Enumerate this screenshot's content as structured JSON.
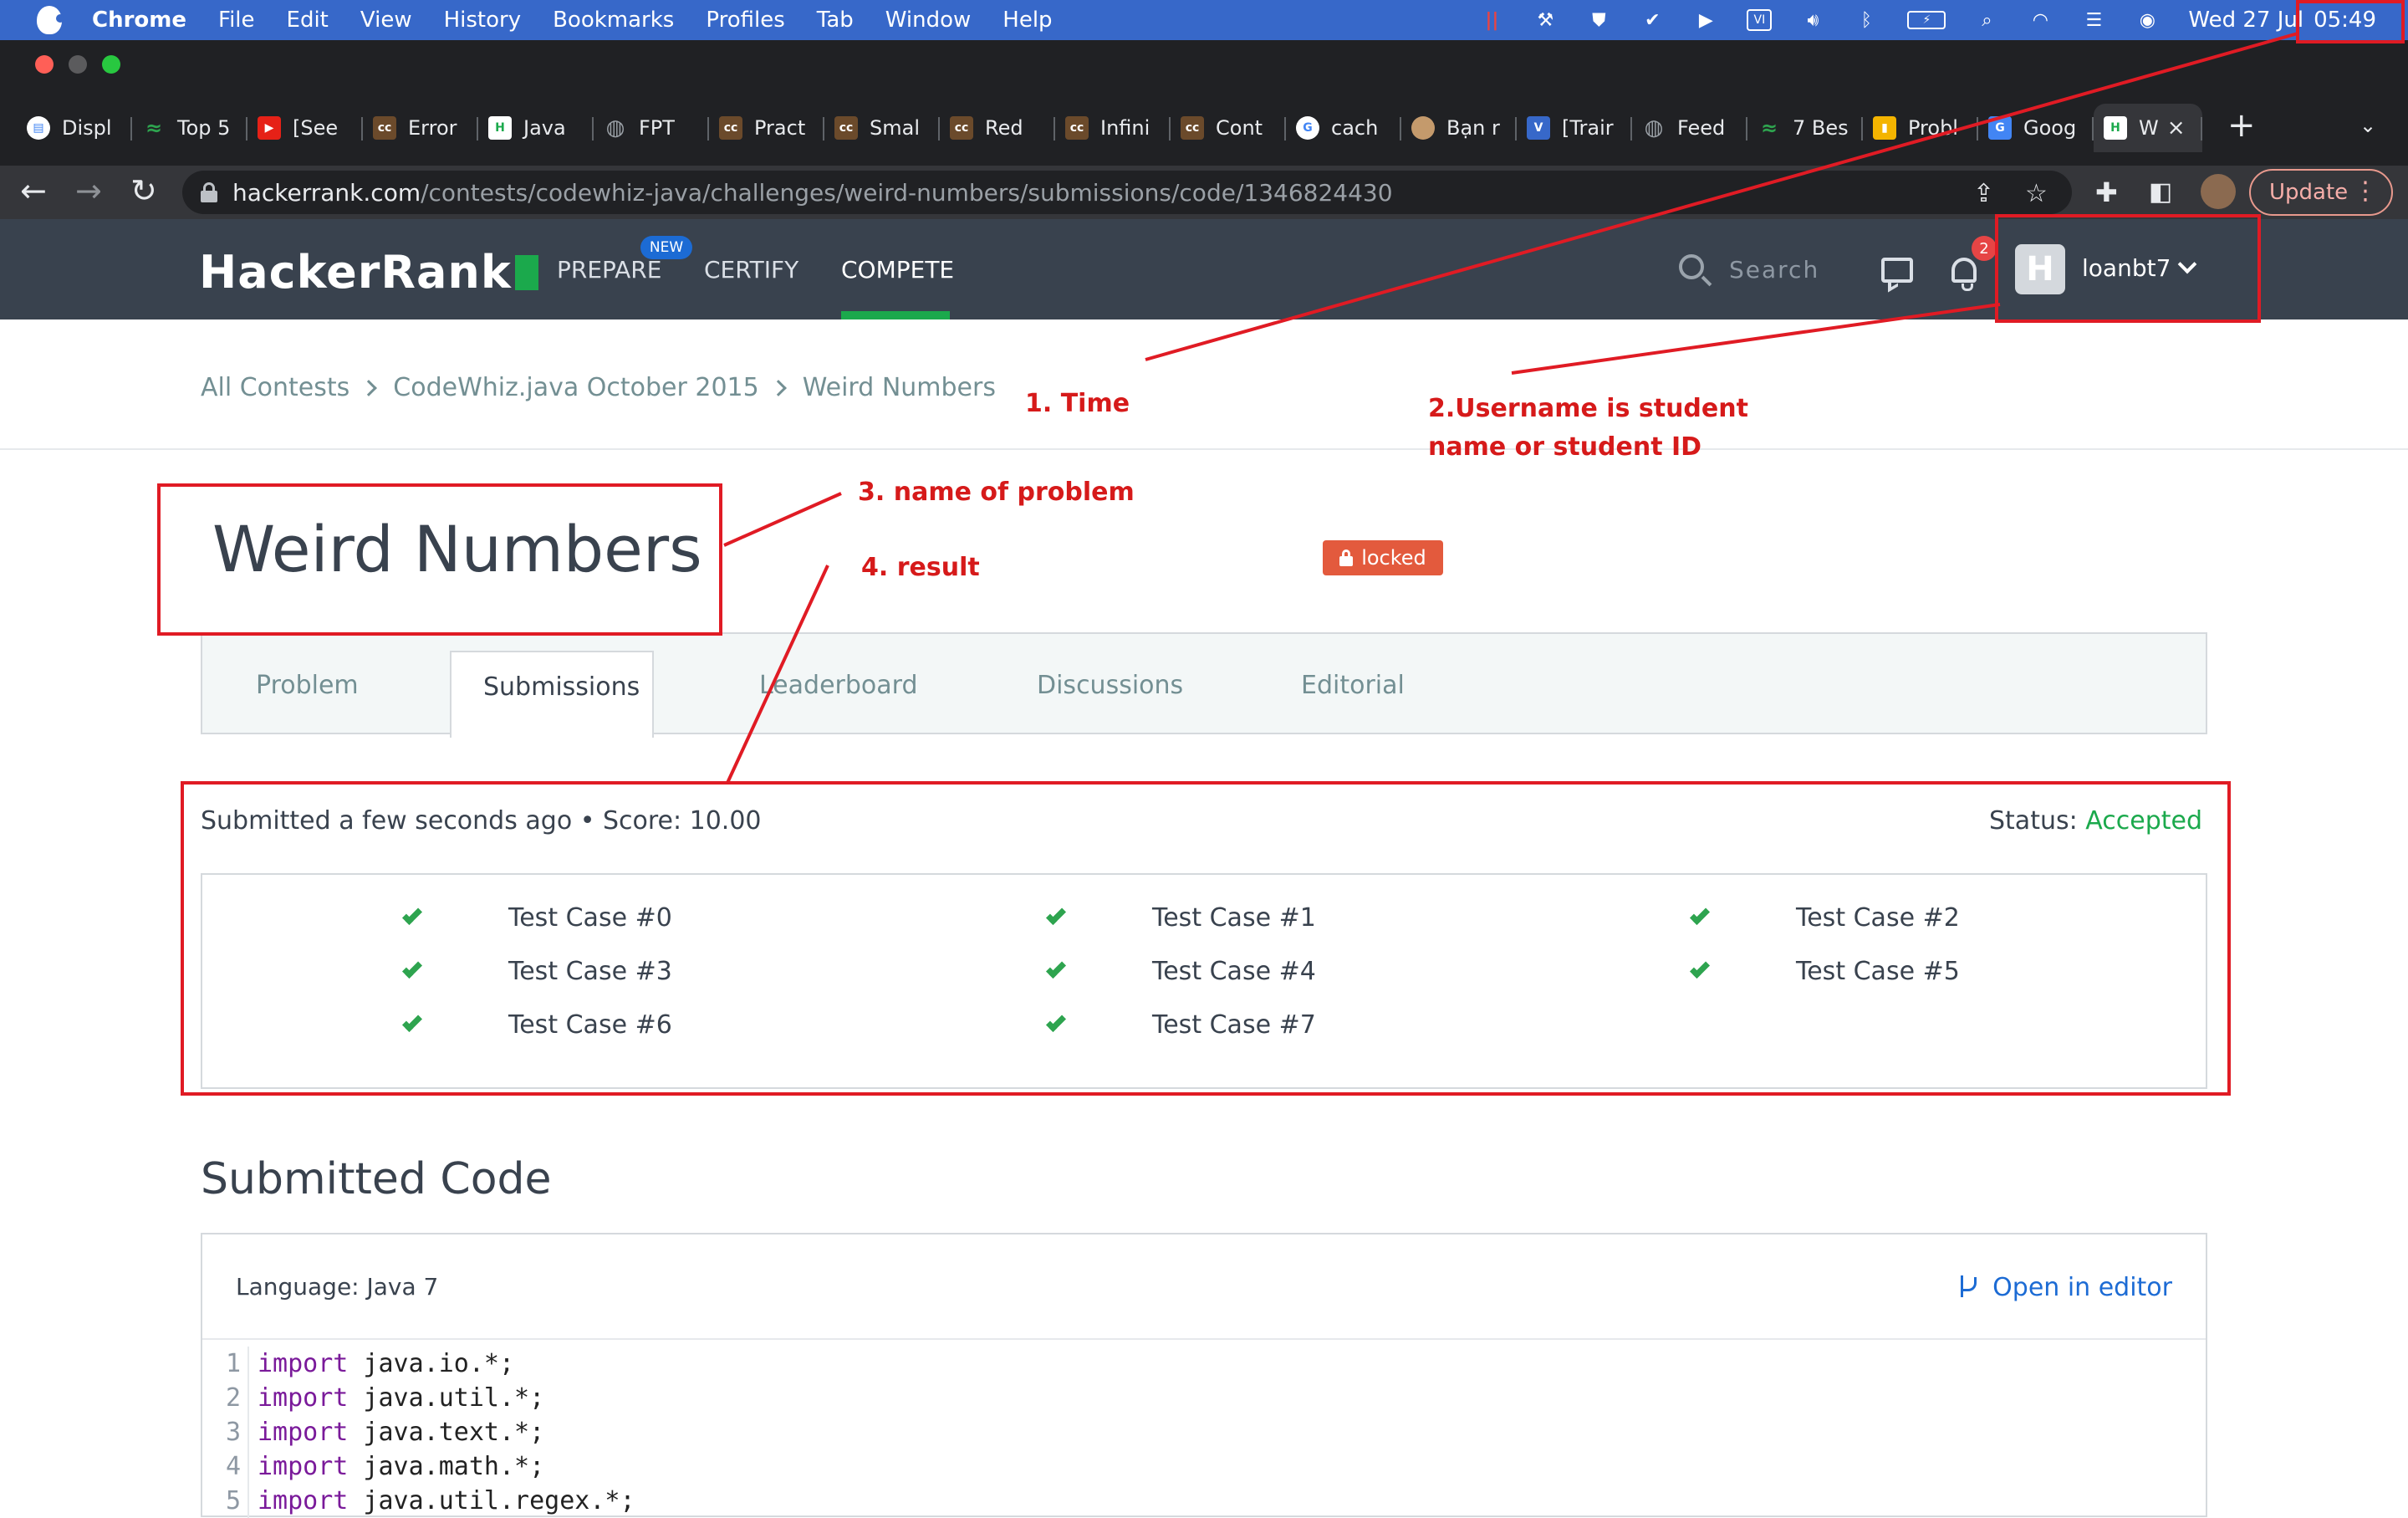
{
  "menubar": {
    "app": "Chrome",
    "items": [
      "File",
      "Edit",
      "View",
      "History",
      "Bookmarks",
      "Profiles",
      "Tab",
      "Window",
      "Help"
    ],
    "clock_date": "Wed 27 Jul",
    "clock_time": "05:49"
  },
  "tabs": [
    {
      "label": "Displ",
      "icon": "doc-icon",
      "color": "#ffffff"
    },
    {
      "label": "Top 5",
      "icon": "leetcode-icon",
      "color": "#2ea44f"
    },
    {
      "label": "[See",
      "icon": "youtube-icon",
      "color": "#e62117"
    },
    {
      "label": "Error",
      "icon": "cc-icon",
      "color": "#6b4a2b"
    },
    {
      "label": "Java",
      "icon": "hackerrank-icon",
      "color": "#1ba94c"
    },
    {
      "label": "FPT",
      "icon": "globe-icon",
      "color": "#9aa0a6"
    },
    {
      "label": "Pract",
      "icon": "cc-icon",
      "color": "#6b4a2b"
    },
    {
      "label": "Smal",
      "icon": "cc-icon",
      "color": "#6b4a2b"
    },
    {
      "label": "Red",
      "icon": "cc-icon",
      "color": "#6b4a2b"
    },
    {
      "label": "Infini",
      "icon": "cc-icon",
      "color": "#6b4a2b"
    },
    {
      "label": "Cont",
      "icon": "cc-icon",
      "color": "#6b4a2b"
    },
    {
      "label": "cach",
      "icon": "google-icon",
      "color": "#ffffff"
    },
    {
      "label": "Bạn r",
      "icon": "avatar-icon",
      "color": "#c49a6c"
    },
    {
      "label": "[Trair",
      "icon": "vue-icon",
      "color": "#3768c9"
    },
    {
      "label": "Feed",
      "icon": "globe-icon",
      "color": "#9aa0a6"
    },
    {
      "label": "7 Bes",
      "icon": "leetcode-icon",
      "color": "#2ea44f"
    },
    {
      "label": "Probl",
      "icon": "chart-icon",
      "color": "#f4b400"
    },
    {
      "label": "Goog",
      "icon": "translate-icon",
      "color": "#4285f4"
    },
    {
      "label": "W",
      "icon": "hackerrank-icon",
      "color": "#1ba94c",
      "active": true
    }
  ],
  "toolbar": {
    "url_domain": "hackerrank.com",
    "url_path": "/contests/codewhiz-java/challenges/weird-numbers/submissions/code/1346824430",
    "update_label": "Update"
  },
  "hrnav": {
    "logo": "HackerRank",
    "prepare": "PREPARE",
    "new_badge": "NEW",
    "certify": "CERTIFY",
    "compete": "COMPETE",
    "search_placeholder": "Search",
    "notification_count": "2",
    "avatar_letter": "H",
    "username": "loanbt7"
  },
  "breadcrumb": [
    "All Contests",
    "CodeWhiz.java October 2015",
    "Weird Numbers"
  ],
  "problem": {
    "title": "Weird Numbers",
    "locked_label": "locked"
  },
  "content_tabs": [
    "Problem",
    "Submissions",
    "Leaderboard",
    "Discussions",
    "Editorial"
  ],
  "submission": {
    "info": "Submitted a few seconds ago • Score: 10.00",
    "status_label": "Status: ",
    "status_value": "Accepted",
    "test_cases": [
      "Test Case #0",
      "Test Case #1",
      "Test Case #2",
      "Test Case #3",
      "Test Case #4",
      "Test Case #5",
      "Test Case #6",
      "Test Case #7"
    ]
  },
  "code": {
    "heading": "Submitted Code",
    "language": "Language: Java 7",
    "open_editor": "Open in editor",
    "lines": [
      {
        "n": "1",
        "kw": "import",
        "text": " java.io.*;"
      },
      {
        "n": "2",
        "kw": "import",
        "text": " java.util.*;"
      },
      {
        "n": "3",
        "kw": "import",
        "text": " java.text.*;"
      },
      {
        "n": "4",
        "kw": "import",
        "text": " java.math.*;"
      },
      {
        "n": "5",
        "kw": "import",
        "text": " java.util.regex.*;"
      }
    ]
  },
  "annotations": {
    "time": "1. Time",
    "username_line1": "2.Username is student",
    "username_line2": "name or student ID",
    "problem_name": "3. name of problem",
    "result": "4. result",
    "color": "#e01b24"
  },
  "colors": {
    "accent_green": "#1ba94c",
    "nav_bg": "#39424e",
    "link_blue": "#1c6bd4",
    "locked_red": "#e35a3d"
  }
}
